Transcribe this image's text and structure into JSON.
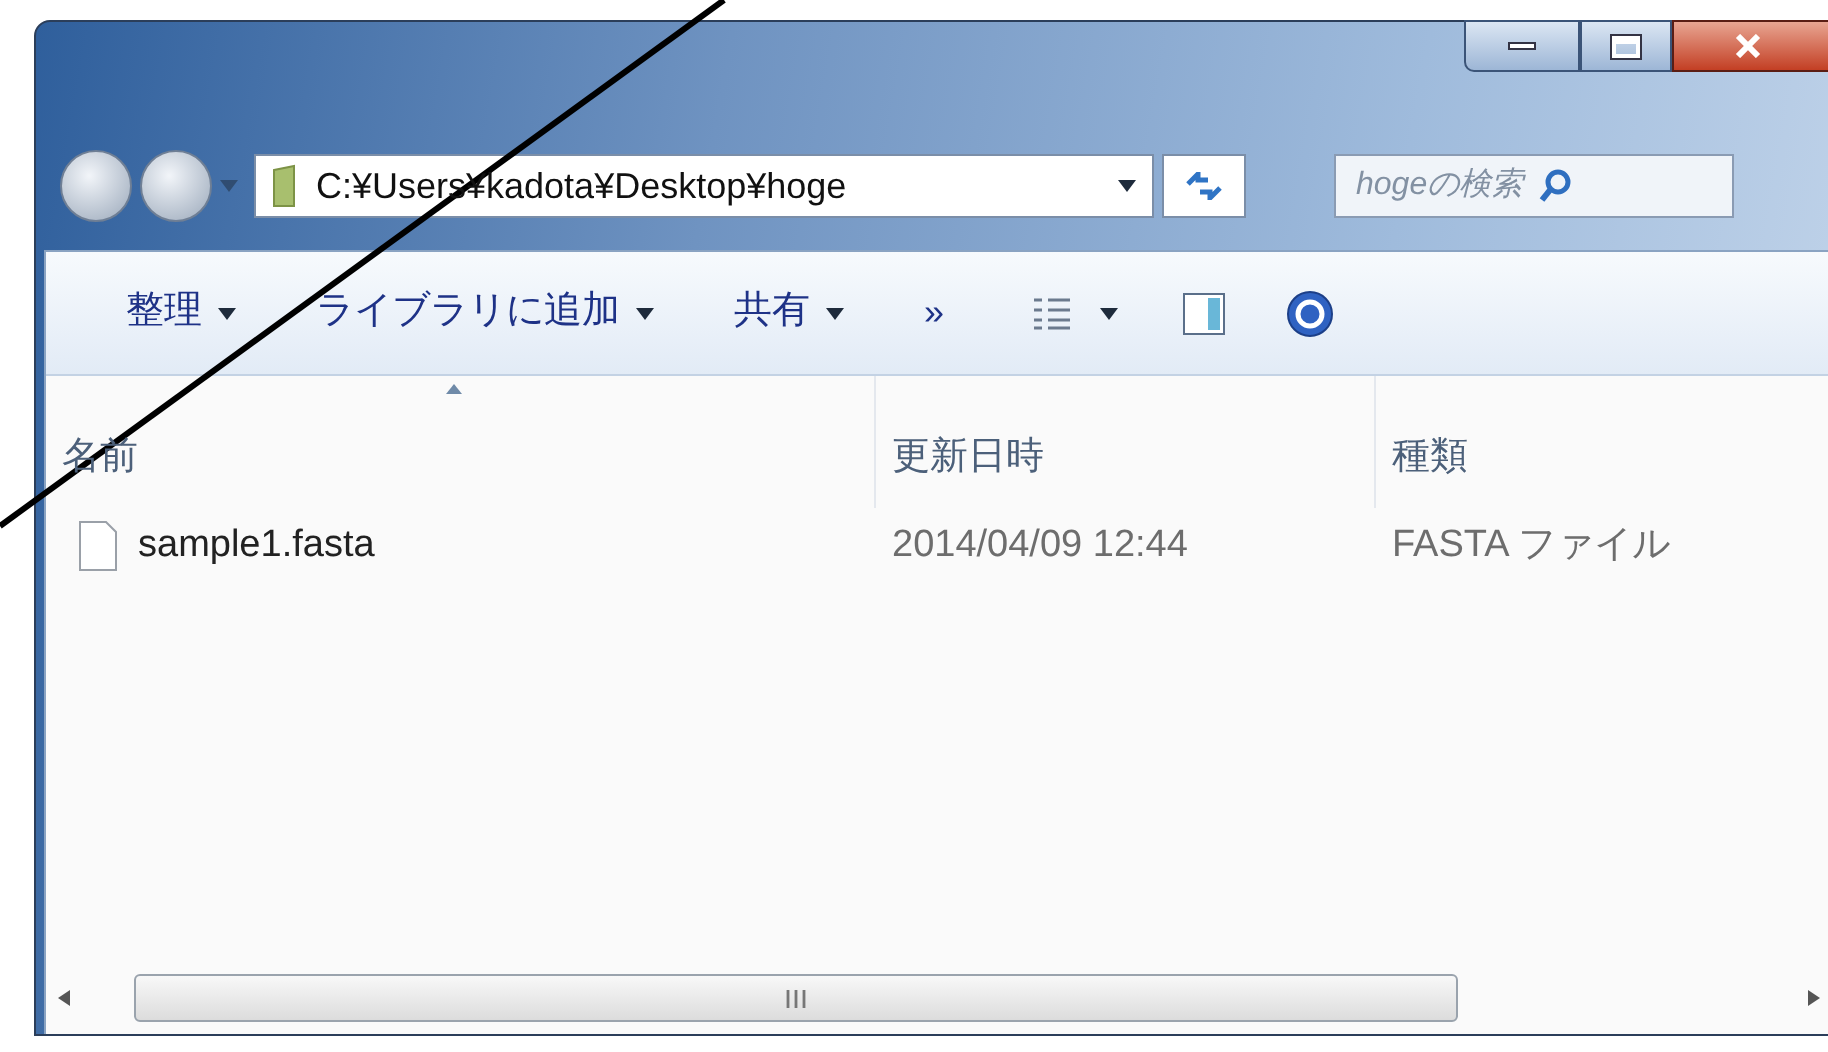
{
  "address_bar": {
    "path": "C:¥Users¥kadota¥Desktop¥hoge"
  },
  "search": {
    "placeholder": "hogeの検索"
  },
  "toolbar": {
    "menus": [
      {
        "label": "整理"
      },
      {
        "label": "ライブラリに追加"
      },
      {
        "label": "共有"
      }
    ],
    "overflow": "»"
  },
  "columns": [
    {
      "label": "名前",
      "sorted": true
    },
    {
      "label": "更新日時",
      "sorted": false
    },
    {
      "label": "種類",
      "sorted": false
    }
  ],
  "rows": [
    {
      "name": "sample1.fasta",
      "modified": "2014/04/09 12:44",
      "type": "FASTA ファイル"
    }
  ]
}
